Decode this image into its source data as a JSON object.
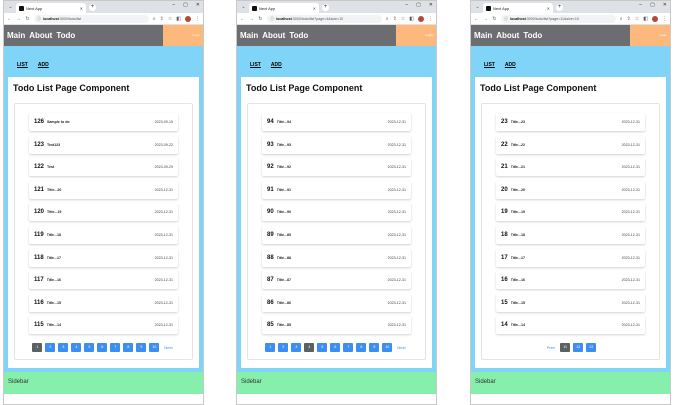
{
  "common": {
    "tab_title": "Next App",
    "nav": [
      "Main",
      "About",
      "Todo"
    ],
    "login_label": "Login",
    "sub_links": [
      "LIST",
      "ADD"
    ],
    "card_title": "Todo List Page Component",
    "sidebar_label": "Sidebar",
    "prev_label": "Prev",
    "next_label": "Next",
    "colors": {
      "nav_bg": "#6b6d70",
      "login_bg": "#fdb97c",
      "main_bg": "#80d4f7",
      "sidebar_bg": "#86efac",
      "page_btn": "#3d8ef2",
      "page_current": "#5d6063"
    }
  },
  "windows": [
    {
      "url_host": "localhost",
      "url_path": ":3000/todo/list",
      "todos": [
        {
          "tno": "126",
          "title": "Sample to do",
          "due": "2023-09-15"
        },
        {
          "tno": "123",
          "title": "Test123",
          "due": "2023-09-22"
        },
        {
          "tno": "122",
          "title": "Test",
          "due": "2023-09-29"
        },
        {
          "tno": "121",
          "title": "Title...20",
          "due": "2023-12-31"
        },
        {
          "tno": "120",
          "title": "Title...19",
          "due": "2023-12-31"
        },
        {
          "tno": "119",
          "title": "Title...18",
          "due": "2023-12-31"
        },
        {
          "tno": "118",
          "title": "Title...17",
          "due": "2023-12-31"
        },
        {
          "tno": "117",
          "title": "Title...16",
          "due": "2023-12-31"
        },
        {
          "tno": "116",
          "title": "Title...15",
          "due": "2023-12-31"
        },
        {
          "tno": "115",
          "title": "Title...14",
          "due": "2023-12-31"
        }
      ],
      "pages": [
        "1",
        "2",
        "3",
        "4",
        "5",
        "6",
        "7",
        "8",
        "9",
        "10"
      ],
      "current_page": "1",
      "show_prev": false,
      "show_next": true
    },
    {
      "url_host": "localhost",
      "url_path": ":3000/todo/list?page=4&size=10",
      "todos": [
        {
          "tno": "94",
          "title": "Title...94",
          "due": "2023-12-31"
        },
        {
          "tno": "93",
          "title": "Title...93",
          "due": "2023-12-31"
        },
        {
          "tno": "92",
          "title": "Title...92",
          "due": "2023-12-31"
        },
        {
          "tno": "91",
          "title": "Title...91",
          "due": "2023-12-31"
        },
        {
          "tno": "90",
          "title": "Title...90",
          "due": "2023-12-31"
        },
        {
          "tno": "89",
          "title": "Title...89",
          "due": "2023-12-31"
        },
        {
          "tno": "88",
          "title": "Title...88",
          "due": "2023-12-31"
        },
        {
          "tno": "87",
          "title": "Title...87",
          "due": "2023-12-31"
        },
        {
          "tno": "86",
          "title": "Title...86",
          "due": "2023-12-31"
        },
        {
          "tno": "85",
          "title": "Title...85",
          "due": "2023-12-31"
        }
      ],
      "pages": [
        "1",
        "2",
        "3",
        "4",
        "5",
        "6",
        "7",
        "8",
        "9",
        "10"
      ],
      "current_page": "4",
      "show_prev": false,
      "show_next": true
    },
    {
      "url_host": "localhost",
      "url_path": ":3000/todo/list?page=11&size=10",
      "todos": [
        {
          "tno": "23",
          "title": "Title...23",
          "due": "2023-12-31"
        },
        {
          "tno": "22",
          "title": "Title...22",
          "due": "2023-12-31"
        },
        {
          "tno": "21",
          "title": "Title...21",
          "due": "2023-12-31"
        },
        {
          "tno": "20",
          "title": "Title...20",
          "due": "2023-12-31"
        },
        {
          "tno": "19",
          "title": "Title...19",
          "due": "2023-12-31"
        },
        {
          "tno": "18",
          "title": "Title...18",
          "due": "2023-12-31"
        },
        {
          "tno": "17",
          "title": "Title...17",
          "due": "2023-12-31"
        },
        {
          "tno": "16",
          "title": "Title...16",
          "due": "2023-12-31"
        },
        {
          "tno": "15",
          "title": "Title...15",
          "due": "2023-12-31"
        },
        {
          "tno": "14",
          "title": "Title...14",
          "due": "2023-12-31"
        }
      ],
      "pages": [
        "11",
        "12",
        "13"
      ],
      "current_page": "11",
      "show_prev": true,
      "show_next": false
    }
  ]
}
